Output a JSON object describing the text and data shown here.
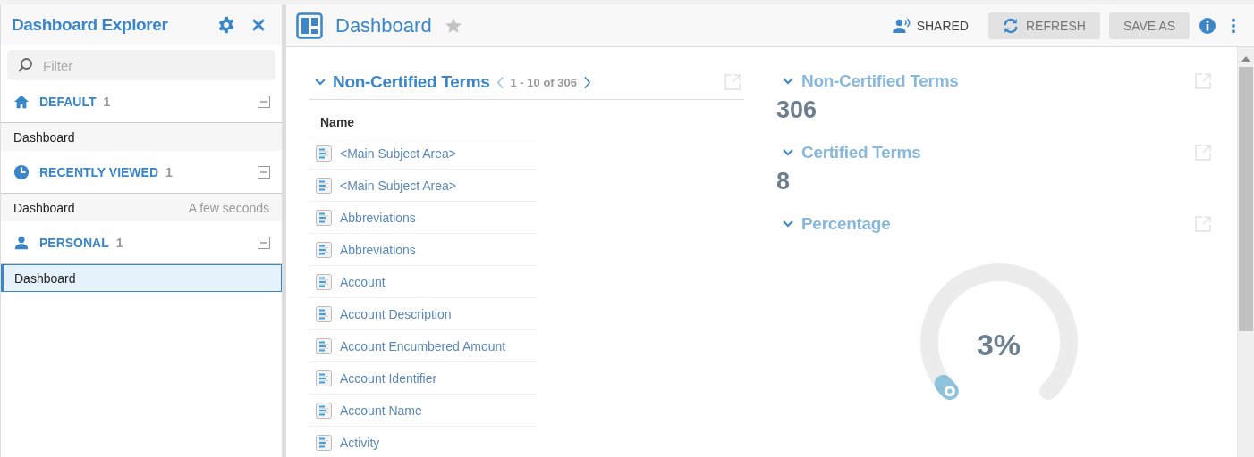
{
  "sidebar": {
    "title": "Dashboard Explorer",
    "filter": {
      "placeholder": "Filter"
    },
    "sections": [
      {
        "kind": "home",
        "label": "DEFAULT",
        "count": "1",
        "expanded": true,
        "items": [
          {
            "label": "Dashboard",
            "selected": false
          }
        ]
      },
      {
        "kind": "clock",
        "label": "RECENTLY VIEWED",
        "count": "1",
        "expanded": true,
        "items": [
          {
            "label": "Dashboard",
            "time": "A few seconds",
            "selected": false
          }
        ]
      },
      {
        "kind": "person",
        "label": "PERSONAL",
        "count": "1",
        "expanded": true,
        "items": [
          {
            "label": "Dashboard",
            "selected": true
          }
        ]
      }
    ]
  },
  "header": {
    "title": "Dashboard",
    "favorite": false,
    "shared": "SHARED",
    "buttons": [
      "REFRESH",
      "SAVE AS"
    ]
  },
  "list_widget": {
    "title": "Non-Certified Terms",
    "range": "1 - 10 of 306",
    "column": "Name",
    "rows": [
      "<Main Subject Area>",
      "<Main Subject Area>",
      "Abbreviations",
      "Abbreviations",
      "Account",
      "Account Description",
      "Account Encumbered Amount",
      "Account Identifier",
      "Account Name",
      "Activity"
    ]
  },
  "metrics": [
    {
      "title": "Non-Certified Terms",
      "value": "306"
    },
    {
      "title": "Certified Terms",
      "value": "8"
    }
  ],
  "gauge": {
    "title": "Percentage",
    "reading": "3%"
  }
}
